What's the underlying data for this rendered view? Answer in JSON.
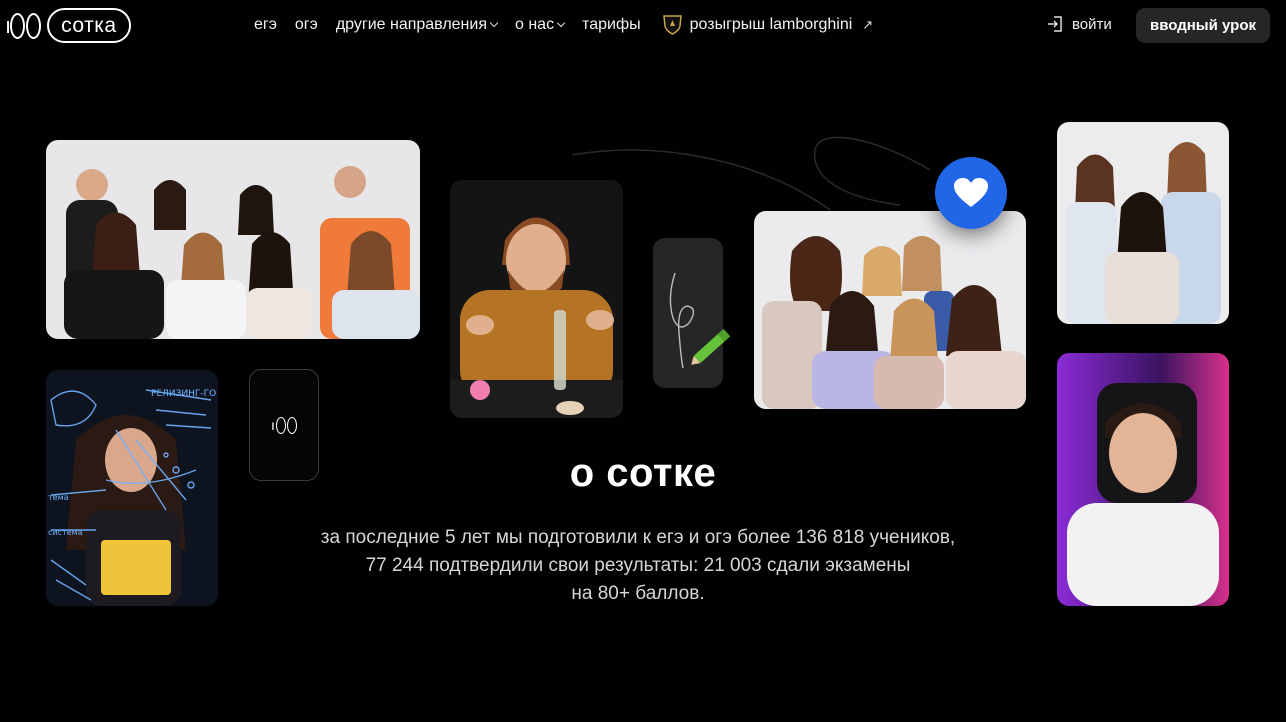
{
  "header": {
    "logo_mark": "100",
    "logo_text": "сотка",
    "nav": [
      {
        "label": "егэ",
        "dropdown": false
      },
      {
        "label": "огэ",
        "dropdown": false
      },
      {
        "label": "другие направления",
        "dropdown": true
      },
      {
        "label": "о нас",
        "dropdown": true
      },
      {
        "label": "тарифы",
        "dropdown": false
      }
    ],
    "promo_label": "розыгрыш lamborghini",
    "promo_icon": "lamborghini-shield-icon",
    "login_label": "войти",
    "login_icon": "login-icon",
    "cta_label": "вводный урок"
  },
  "hero": {
    "title": "о сотке",
    "line1": "за последние 5 лет мы подготовили к егэ и огэ более 136 818 учеников,",
    "line2": "77 244 подтвердили свои результаты: 21 003 сдали экзамены",
    "line3": "на 80+ баллов."
  },
  "cards": {
    "phone_mark": "100",
    "heart_icon": "heart-icon",
    "pencil_icon": "pencil-icon"
  },
  "colors": {
    "background": "#010101",
    "accent_blue": "#2166e6",
    "cta_bg": "#262626",
    "text_muted": "#d6d6d6"
  }
}
